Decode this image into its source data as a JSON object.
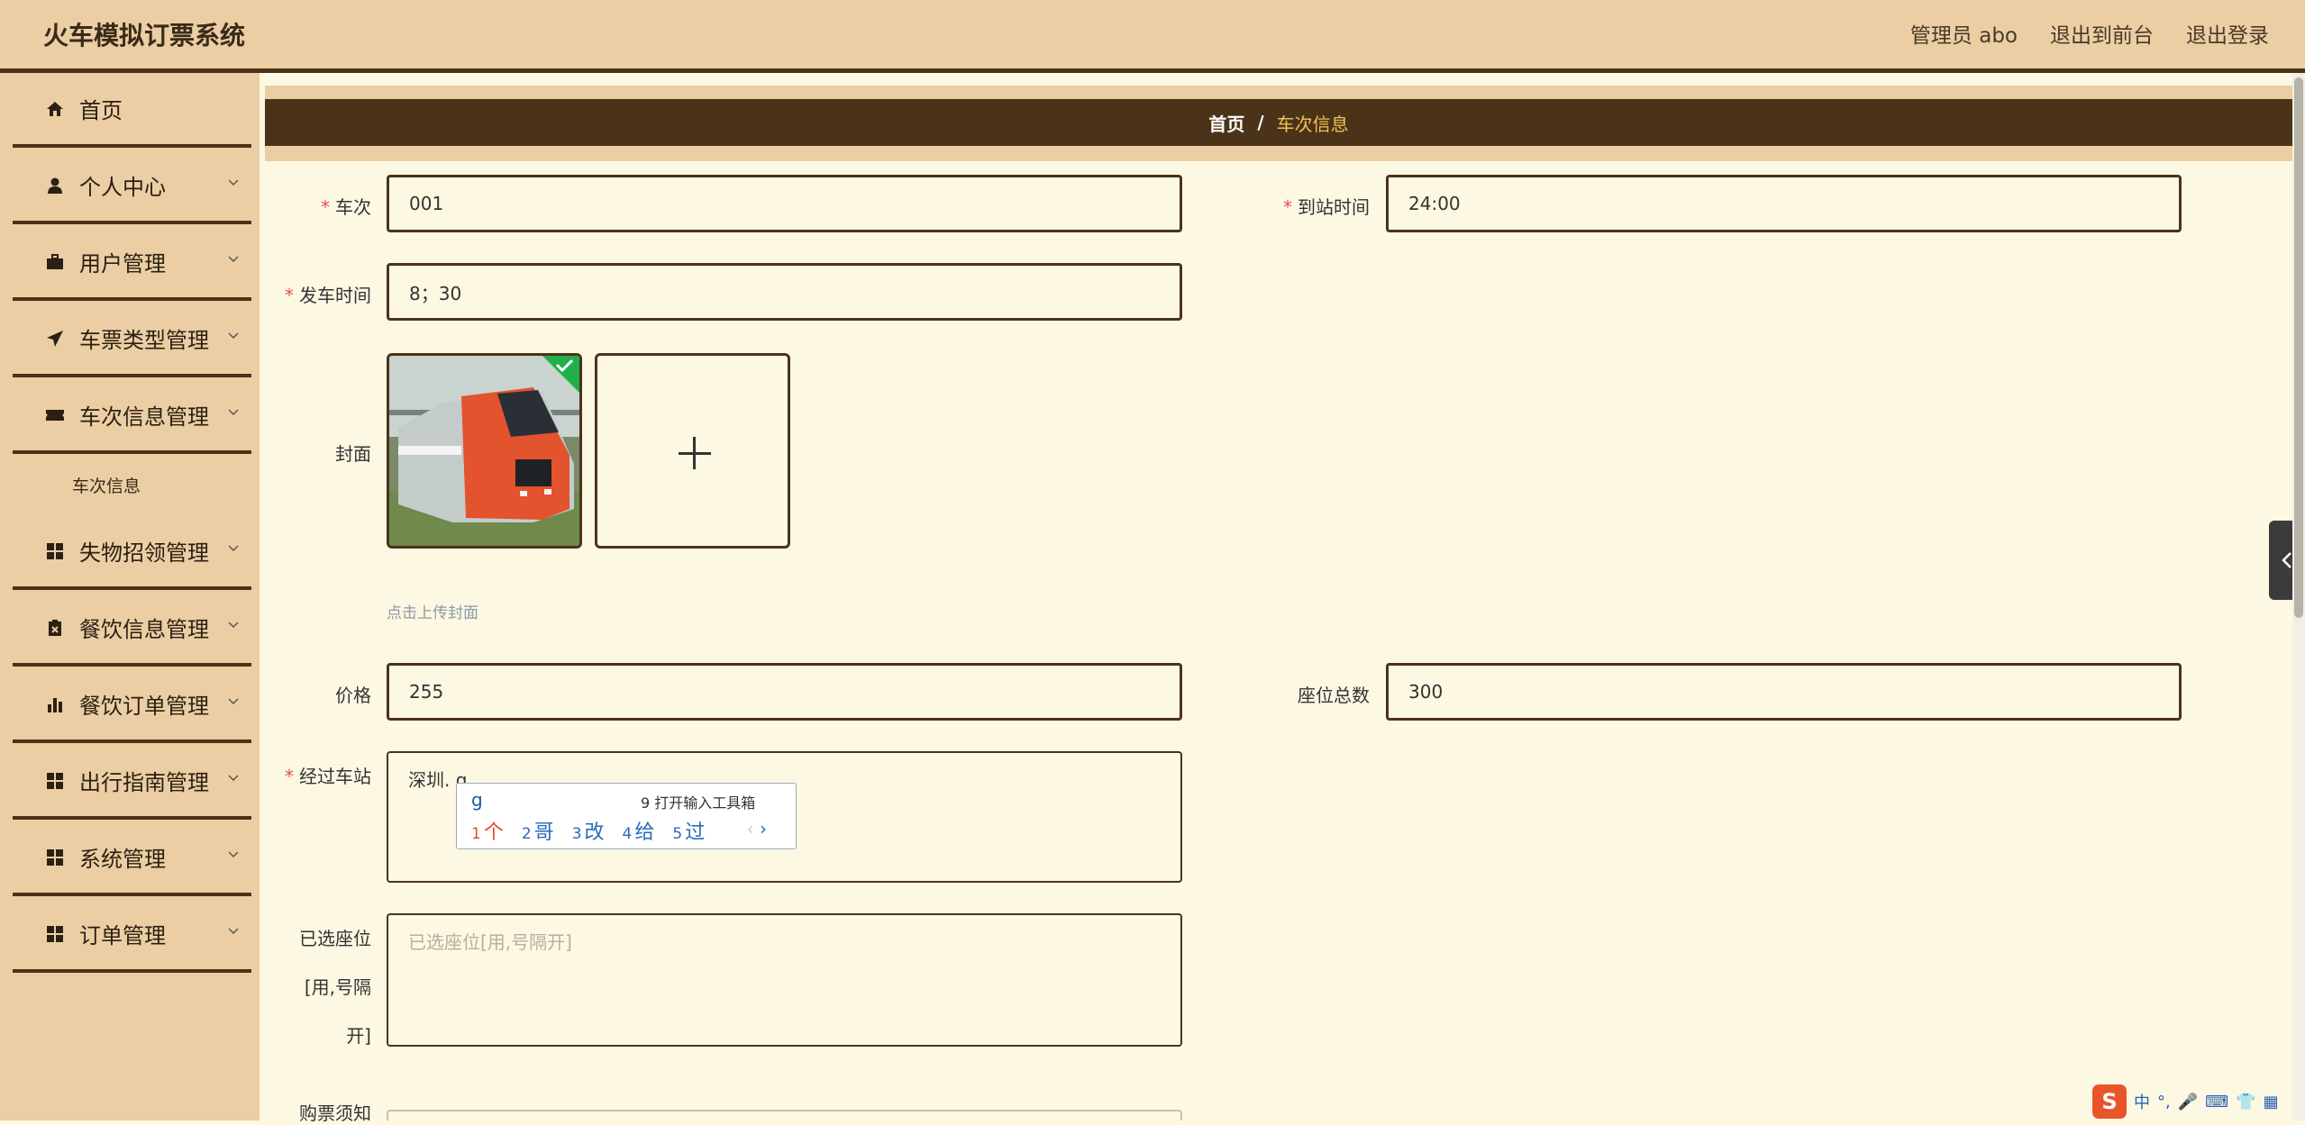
{
  "header": {
    "title": "火车模拟订票系统",
    "admin_label": "管理员 abo",
    "to_front_label": "退出到前台",
    "logout_label": "退出登录"
  },
  "sidebar": {
    "items": [
      {
        "label": "首页",
        "icon": "home-icon"
      },
      {
        "label": "个人中心",
        "icon": "user-icon"
      },
      {
        "label": "用户管理",
        "icon": "briefcase-icon"
      },
      {
        "label": "车票类型管理",
        "icon": "send-icon"
      },
      {
        "label": "车次信息管理",
        "icon": "ticket-icon"
      },
      {
        "label": "失物招领管理",
        "icon": "grid-icon"
      },
      {
        "label": "餐饮信息管理",
        "icon": "clipboard-icon"
      },
      {
        "label": "餐饮订单管理",
        "icon": "bar-chart-icon"
      },
      {
        "label": "出行指南管理",
        "icon": "grid-icon"
      },
      {
        "label": "系统管理",
        "icon": "grid-icon"
      },
      {
        "label": "订单管理",
        "icon": "grid-icon"
      }
    ],
    "subitem": "车次信息"
  },
  "breadcrumb": {
    "home": "首页",
    "separator": "/",
    "current": "车次信息"
  },
  "form": {
    "train_no_label": "车次",
    "train_no_value": "001",
    "arrive_time_label": "到站时间",
    "arrive_time_value": "24:00",
    "depart_time_label": "发车时间",
    "depart_time_value": "8；30",
    "cover_label": "封面",
    "cover_hint": "点击上传封面",
    "price_label": "价格",
    "price_value": "255",
    "seats_label": "座位总数",
    "seats_value": "300",
    "stations_label": "经过车站",
    "stations_value": "深圳. g",
    "selected_seats_label_1": "已选座位",
    "selected_seats_label_2": "[用,号隔",
    "selected_seats_label_3": "开]",
    "selected_seats_placeholder": "已选座位[用,号隔开]",
    "notice_label": "购票须知"
  },
  "ime": {
    "input": "g",
    "toolbox": "9 打开输入工具箱",
    "candidates": [
      {
        "num": "1",
        "text": "个"
      },
      {
        "num": "2",
        "text": "哥"
      },
      {
        "num": "3",
        "text": "改"
      },
      {
        "num": "4",
        "text": "给"
      },
      {
        "num": "5",
        "text": "过"
      }
    ],
    "nav_prev": "‹",
    "nav_next": "›"
  },
  "taskbar": {
    "ime_logo": "S",
    "ime_mode": "中"
  },
  "colors": {
    "header_bg": "#ebcea3",
    "accent_dark": "#4b3319",
    "page_bg": "#fdf8e2",
    "breadcrumb_active": "#f0c050",
    "required_mark": "#e65050"
  }
}
